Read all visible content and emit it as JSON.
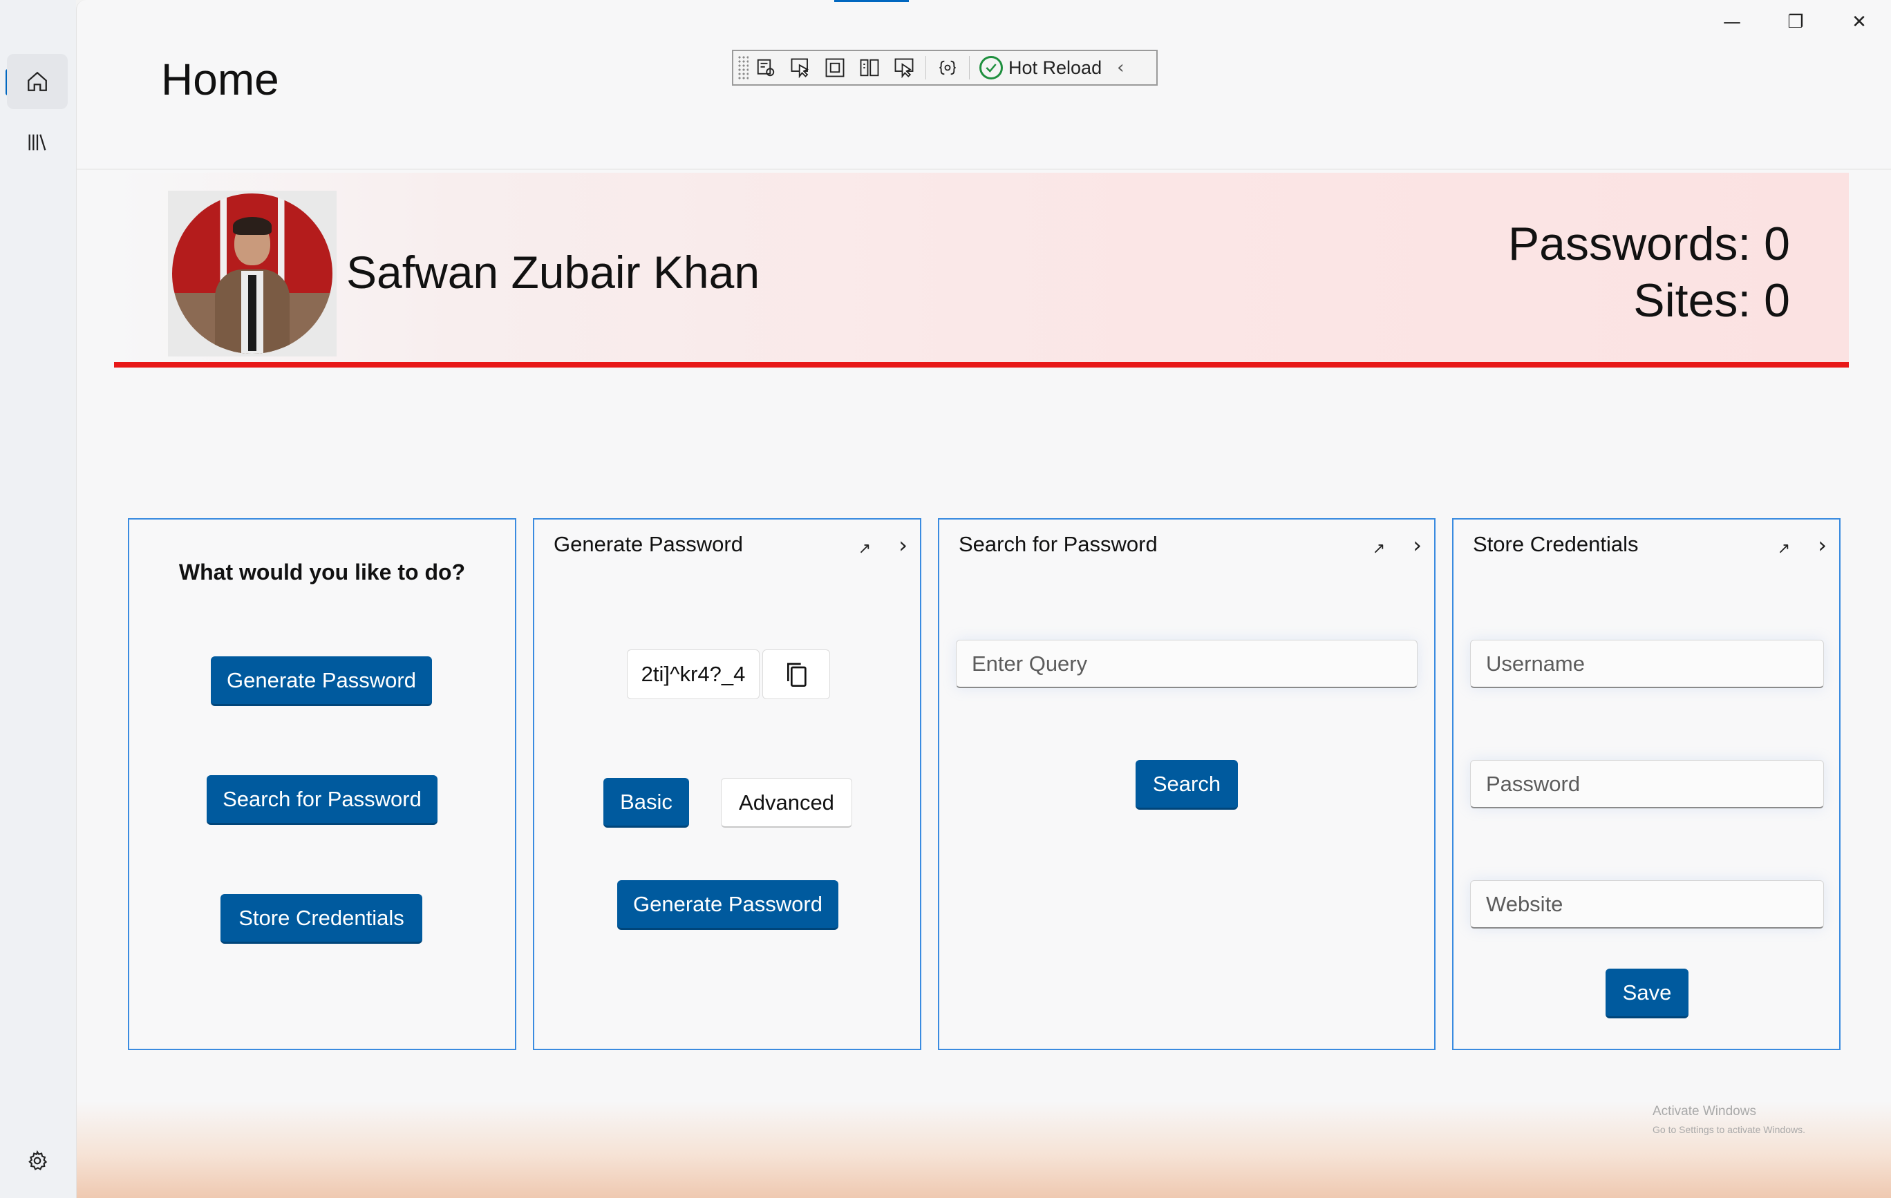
{
  "window": {
    "title": "Home",
    "caption": {
      "minimize": "—",
      "restore": "❐",
      "close": "✕"
    }
  },
  "toolbar": {
    "hot_reload_label": "Hot Reload"
  },
  "sidebar": {
    "items": [
      {
        "name": "home",
        "icon": "home-icon"
      },
      {
        "name": "library",
        "icon": "library-icon"
      }
    ],
    "footer_icon": "settings-icon"
  },
  "profile": {
    "name": "Safwan Zubair Khan",
    "passwords_text": "Passwords: 0",
    "sites_text": "Sites: 0"
  },
  "cards": {
    "actions": {
      "question": "What would you like to do?",
      "generate_label": "Generate Password",
      "search_label": "Search for Password",
      "store_label": "Store Credentials"
    },
    "generate": {
      "title": "Generate Password",
      "password_value": "2ti]^kr4?_4",
      "mode_basic": "Basic",
      "mode_advanced": "Advanced",
      "generate_label": "Generate Password"
    },
    "search": {
      "title": "Search for Password",
      "query_placeholder": "Enter Query",
      "search_label": "Search"
    },
    "store": {
      "title": "Store Credentials",
      "username_placeholder": "Username",
      "password_placeholder": "Password",
      "website_placeholder": "Website",
      "save_label": "Save"
    },
    "expand_glyph": "↗",
    "chevron_glyph": "›"
  },
  "watermark": {
    "line1": "Activate Windows",
    "line2": "Go to Settings to activate Windows."
  },
  "colors": {
    "accent": "#005a9e",
    "card_border": "#3a8be0",
    "header_rule": "#e81818"
  }
}
